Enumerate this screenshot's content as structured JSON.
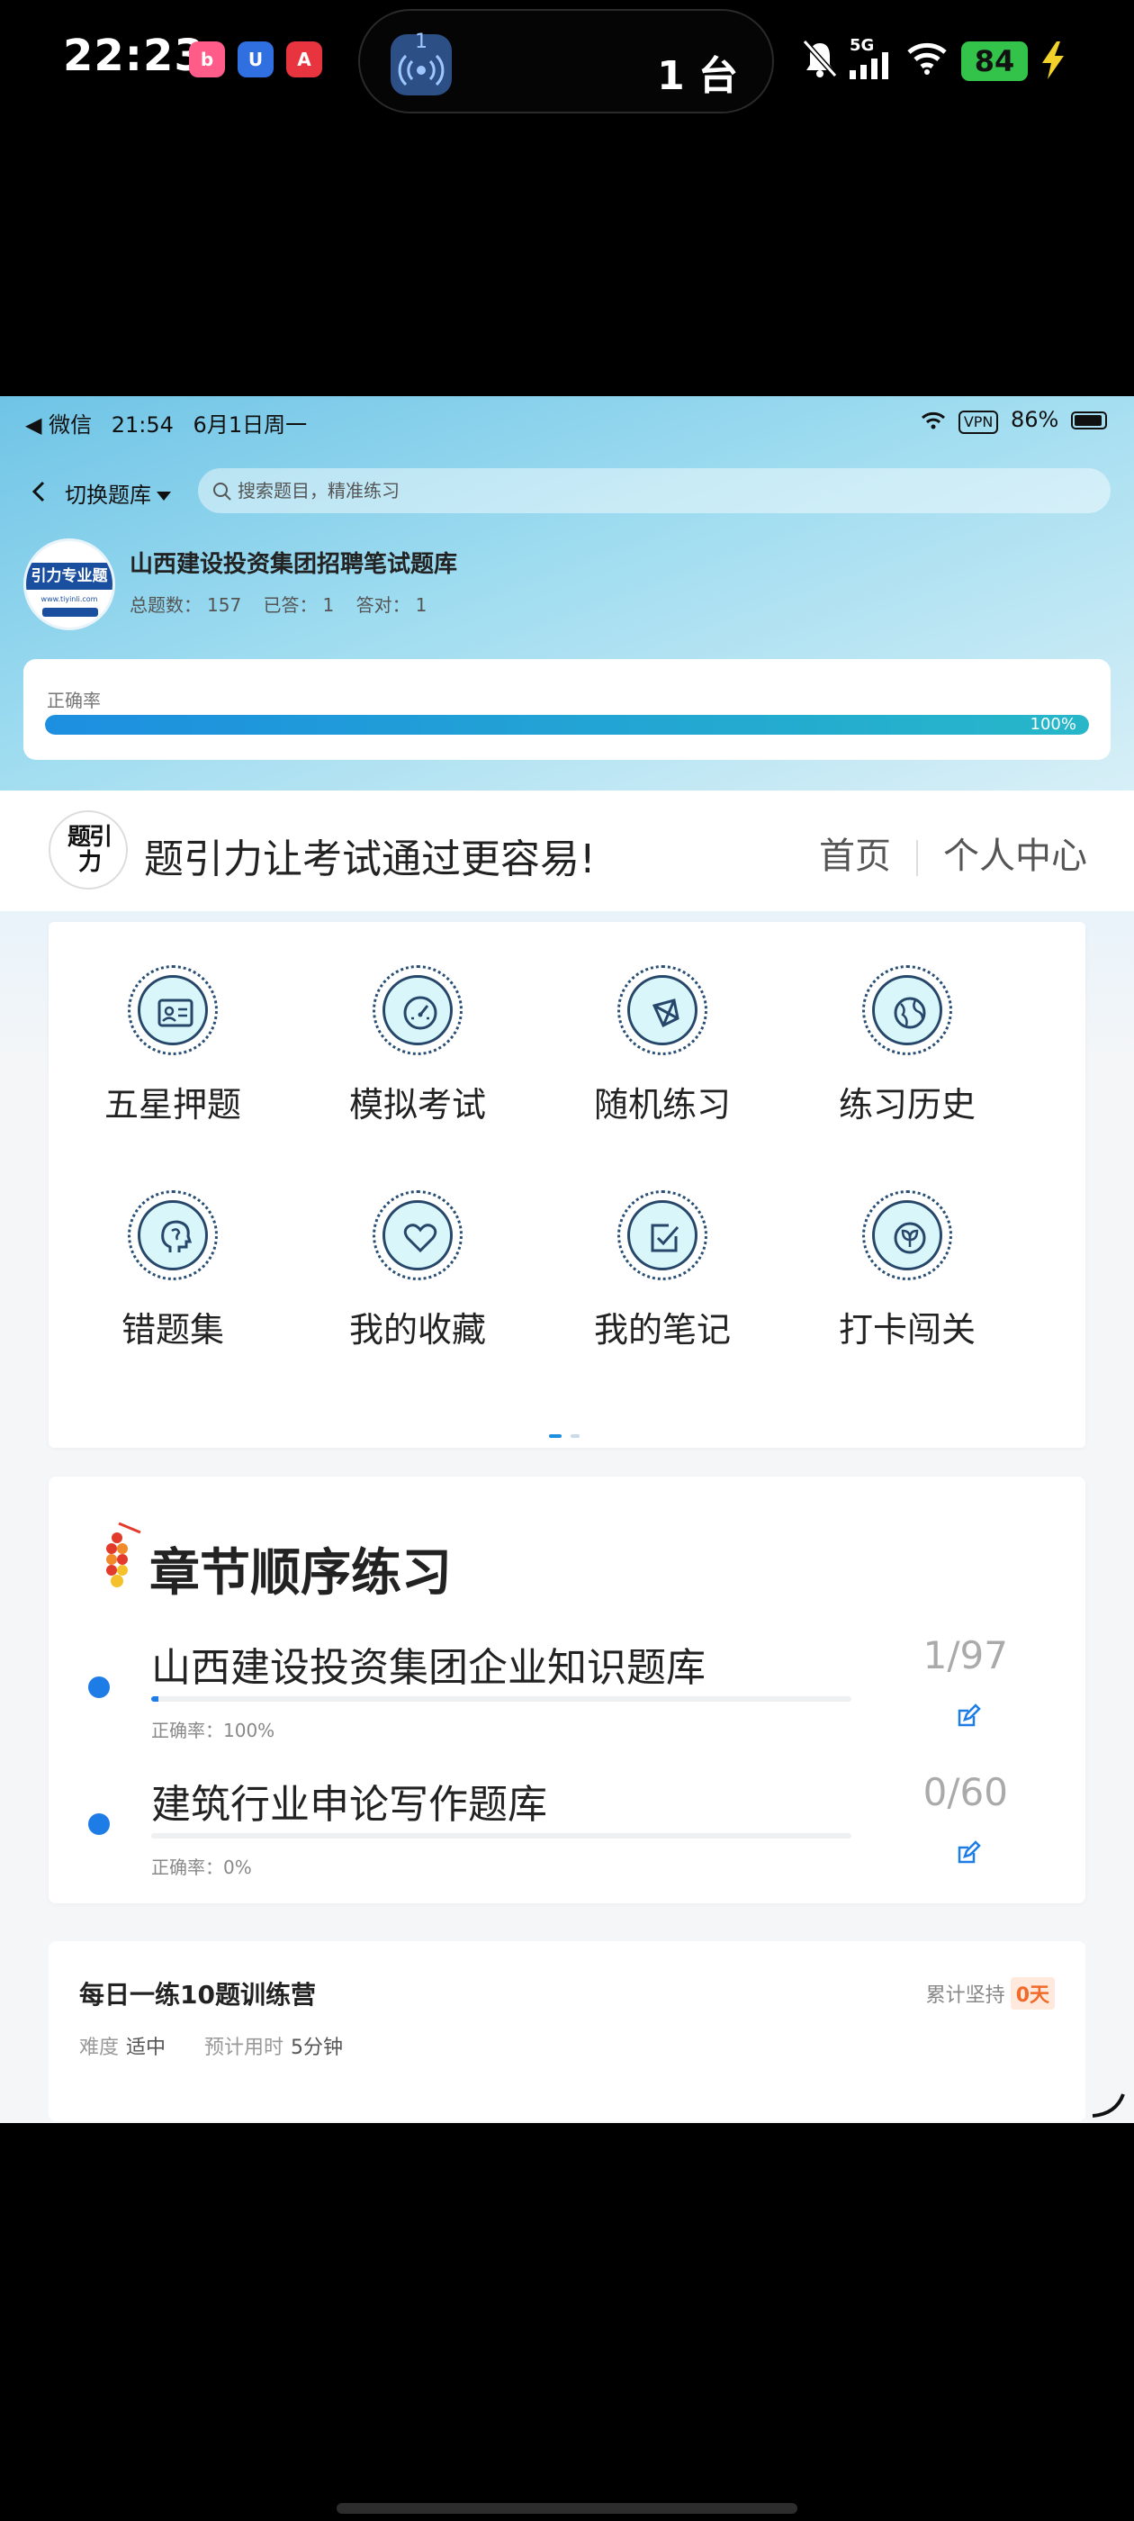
{
  "phone_status": {
    "time": "22:23",
    "live_activity_count": "1",
    "live_activity_text": "1 台",
    "network": "5G",
    "battery": "84",
    "app_icons": [
      "bilibili-icon",
      "shield-app-icon",
      "red-app-icon"
    ]
  },
  "inner_status": {
    "back_app": "◀ 微信",
    "time": "21:54",
    "date": "6月1日周一",
    "vpn": "VPN",
    "battery": "86%"
  },
  "nav": {
    "switch_label": "切换题库",
    "search_placeholder": "搜索题目，精准练习"
  },
  "bank": {
    "logo_text": "引力专业题",
    "logo_url": "www.tiyinli.com",
    "title": "山西建设投资集团招聘笔试题库",
    "total_label": "总题数：",
    "total": "157",
    "answered_label": "已答：",
    "answered": "1",
    "correct_label": "答对：",
    "correct": "1"
  },
  "accuracy": {
    "label": "正确率",
    "value_text": "100%",
    "fraction": 1.0
  },
  "brand": {
    "logo_text": "题引力",
    "slogan": "题引力让考试通过更容易!",
    "nav_home": "首页",
    "nav_profile": "个人中心"
  },
  "menu": [
    {
      "label": "五星押题",
      "icon": "id-card-icon"
    },
    {
      "label": "模拟考试",
      "icon": "gauge-icon"
    },
    {
      "label": "随机练习",
      "icon": "network-icon"
    },
    {
      "label": "练习历史",
      "icon": "globe-icon"
    },
    {
      "label": "错题集",
      "icon": "head-profile-icon"
    },
    {
      "label": "我的收藏",
      "icon": "heart-icon"
    },
    {
      "label": "我的笔记",
      "icon": "check-note-icon"
    },
    {
      "label": "打卡闯关",
      "icon": "leaf-badge-icon"
    }
  ],
  "chapters": {
    "heading": "章节顺序练习",
    "items": [
      {
        "name": "山西建设投资集团企业知识题库",
        "count": "1/97",
        "progress": 0.0103,
        "accuracy_label": "正确率：",
        "accuracy": "100%"
      },
      {
        "name": "建筑行业申论写作题库",
        "count": "0/60",
        "progress": 0,
        "accuracy_label": "正确率：",
        "accuracy": "0%"
      }
    ]
  },
  "daily": {
    "title": "每日一练10题训练营",
    "streak_label": "累计坚持",
    "streak_value": "0天",
    "difficulty_label": "难度",
    "difficulty": "适中",
    "time_label": "预计用时",
    "time": "5分钟"
  },
  "colors": {
    "accent": "#1d8fe0",
    "teal": "#27b7c9",
    "streak": "#f06a2a",
    "icon_fill": "#d9f6fb",
    "icon_stroke": "#26476a"
  }
}
